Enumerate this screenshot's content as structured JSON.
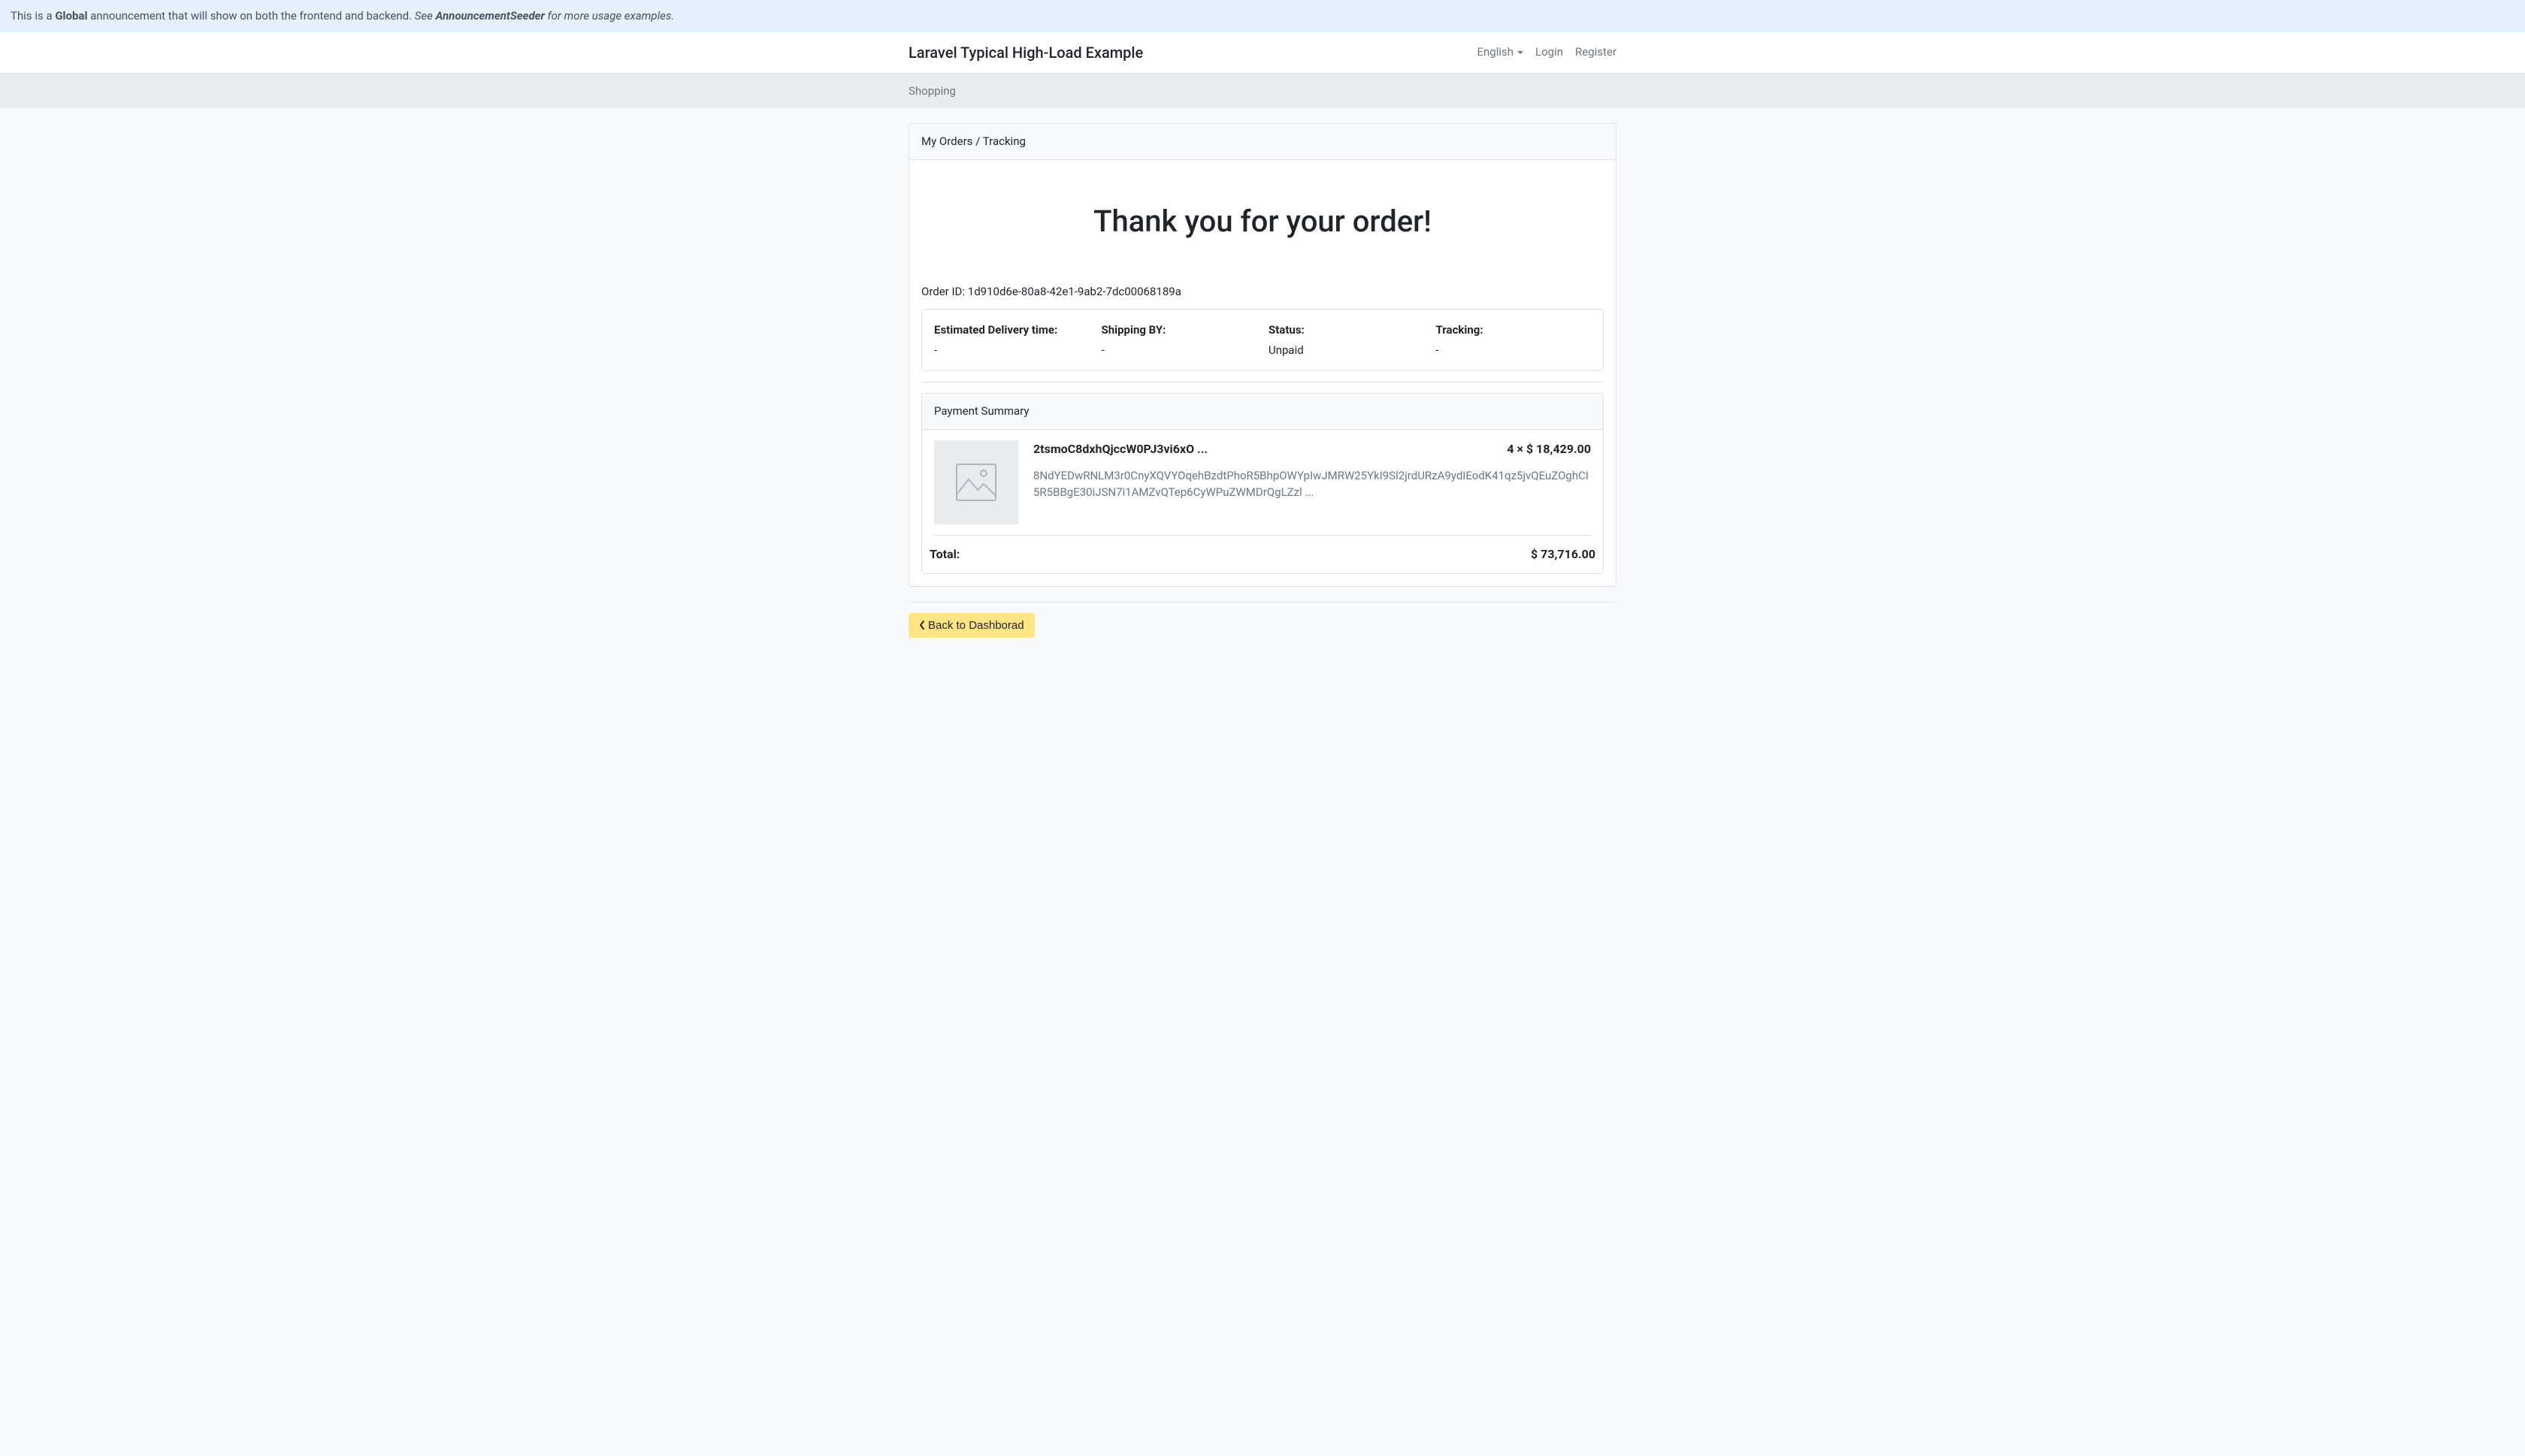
{
  "announcement": {
    "prefix": "This is a ",
    "bold": "Global",
    "mid": " announcement that will show on both the frontend and backend. ",
    "em_prefix": "See ",
    "em_bold": "AnnouncementSeeder",
    "em_suffix": " for more usage examples."
  },
  "navbar": {
    "brand": "Laravel Typical High-Load Example",
    "language": "English",
    "login": "Login",
    "register": "Register"
  },
  "secondary_nav": {
    "shopping": "Shopping"
  },
  "card": {
    "header": "My Orders / Tracking",
    "thank_you": "Thank you for your order!",
    "order_id_label": "Order ID: ",
    "order_id_value": "1d910d6e-80a8-42e1-9ab2-7dc00068189a"
  },
  "info": {
    "delivery_label": "Estimated Delivery time:",
    "delivery_value": "-",
    "shipping_label": "Shipping BY:",
    "shipping_value": "-",
    "status_label": "Status:",
    "status_value": "Unpaid",
    "tracking_label": "Tracking:",
    "tracking_value": "-"
  },
  "payment": {
    "header": "Payment Summary",
    "item_title": "2tsmoC8dxhQjccW0PJ3vi6xO ...",
    "item_price": "4 × $ 18,429.00",
    "item_desc": "8NdYEDwRNLM3r0CnyXQVYOqehBzdtPhoR5BhpOWYpIwJMRW25YkI9Sl2jrdURzA9ydIEodK41qz5jvQEuZOghCI5R5BBgE30iJSN7i1AMZvQTep6CyWPuZWMDrQgLZzl ...",
    "total_label": "Total:",
    "total_value": "$ 73,716.00"
  },
  "back_button": "Back to Dashborad"
}
